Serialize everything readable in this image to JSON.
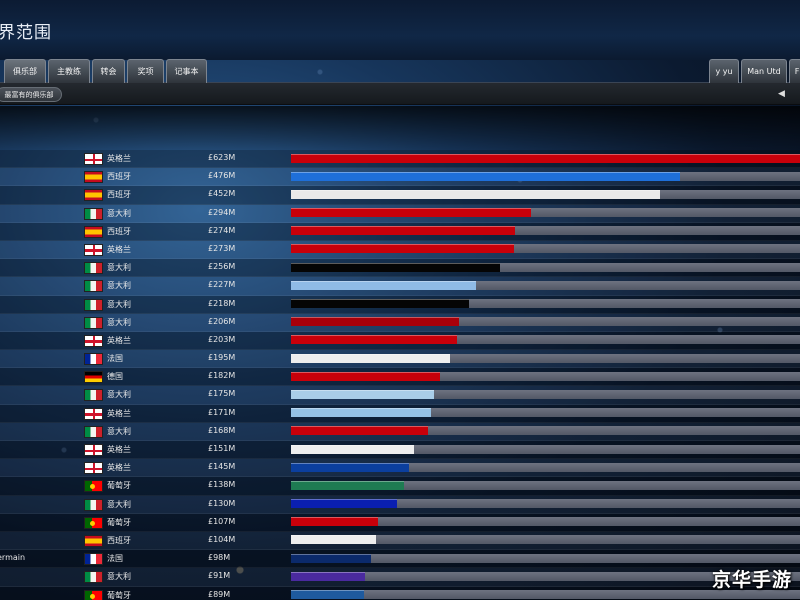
{
  "page_title": "界范围",
  "tabs": [
    {
      "label": "俱乐部",
      "active": true
    },
    {
      "label": "主教练",
      "active": false
    },
    {
      "label": "转会",
      "active": false
    },
    {
      "label": "奖项",
      "active": false
    },
    {
      "label": "记事本",
      "active": false
    }
  ],
  "right_tabs": [
    {
      "label": "y yu"
    },
    {
      "label": "Man Utd"
    },
    {
      "label": "F"
    }
  ],
  "filter_label": "最富有的俱乐部",
  "collapse_icon": "◀",
  "max_value": 623,
  "rows": [
    {
      "club": "",
      "flag": "en",
      "country": "英格兰",
      "value": "£623M",
      "amount": 623,
      "color": "#c8000a"
    },
    {
      "club": "",
      "flag": "es",
      "country": "西班牙",
      "value": "£476M",
      "amount": 476,
      "color": "#1e6fd9"
    },
    {
      "club": "",
      "flag": "es",
      "country": "西班牙",
      "value": "£452M",
      "amount": 452,
      "color": "#e9e9e9"
    },
    {
      "club": "",
      "flag": "it",
      "country": "意大利",
      "value": "£294M",
      "amount": 294,
      "color": "#c8000a"
    },
    {
      "club": "",
      "flag": "es",
      "country": "西班牙",
      "value": "£274M",
      "amount": 274,
      "color": "#c8000a"
    },
    {
      "club": "",
      "flag": "en",
      "country": "英格兰",
      "value": "£273M",
      "amount": 273,
      "color": "#c8000a"
    },
    {
      "club": "",
      "flag": "it",
      "country": "意大利",
      "value": "£256M",
      "amount": 256,
      "color": "#050505"
    },
    {
      "club": "",
      "flag": "it",
      "country": "意大利",
      "value": "£227M",
      "amount": 227,
      "color": "#8fbbe6"
    },
    {
      "club": "",
      "flag": "it",
      "country": "意大利",
      "value": "£218M",
      "amount": 218,
      "color": "#050505"
    },
    {
      "club": "",
      "flag": "it",
      "country": "意大利",
      "value": "£206M",
      "amount": 206,
      "color": "#a8000a"
    },
    {
      "club": "",
      "flag": "en",
      "country": "英格兰",
      "value": "£203M",
      "amount": 203,
      "color": "#c8000a"
    },
    {
      "club": "",
      "flag": "fr",
      "country": "法国",
      "value": "£195M",
      "amount": 195,
      "color": "#eeeeee"
    },
    {
      "club": "",
      "flag": "de",
      "country": "德国",
      "value": "£182M",
      "amount": 182,
      "color": "#c8000a"
    },
    {
      "club": "",
      "flag": "it",
      "country": "意大利",
      "value": "£175M",
      "amount": 175,
      "color": "#a9cde8"
    },
    {
      "club": "",
      "flag": "en",
      "country": "英格兰",
      "value": "£171M",
      "amount": 171,
      "color": "#95c2e6"
    },
    {
      "club": "",
      "flag": "it",
      "country": "意大利",
      "value": "£168M",
      "amount": 168,
      "color": "#c8000a"
    },
    {
      "club": "",
      "flag": "en",
      "country": "英格兰",
      "value": "£151M",
      "amount": 151,
      "color": "#eeeeee"
    },
    {
      "club": "",
      "flag": "en",
      "country": "英格兰",
      "value": "£145M",
      "amount": 145,
      "color": "#0b3f9e"
    },
    {
      "club": "",
      "flag": "pt",
      "country": "葡萄牙",
      "value": "£138M",
      "amount": 138,
      "color": "#1e7b52"
    },
    {
      "club": "",
      "flag": "it",
      "country": "意大利",
      "value": "£130M",
      "amount": 130,
      "color": "#0a1fb0"
    },
    {
      "club": "",
      "flag": "pt",
      "country": "葡萄牙",
      "value": "£107M",
      "amount": 107,
      "color": "#c8000a"
    },
    {
      "club": "",
      "flag": "es",
      "country": "西班牙",
      "value": "£104M",
      "amount": 104,
      "color": "#eeeeee"
    },
    {
      "club": "ermain",
      "flag": "fr",
      "country": "法国",
      "value": "£98M",
      "amount": 98,
      "color": "#0b2a6b"
    },
    {
      "club": "",
      "flag": "it",
      "country": "意大利",
      "value": "£91M",
      "amount": 91,
      "color": "#4a2a9e"
    },
    {
      "club": "",
      "flag": "pt",
      "country": "葡萄牙",
      "value": "£89M",
      "amount": 89,
      "color": "#1e5a9e"
    }
  ],
  "watermark": "京华手游"
}
